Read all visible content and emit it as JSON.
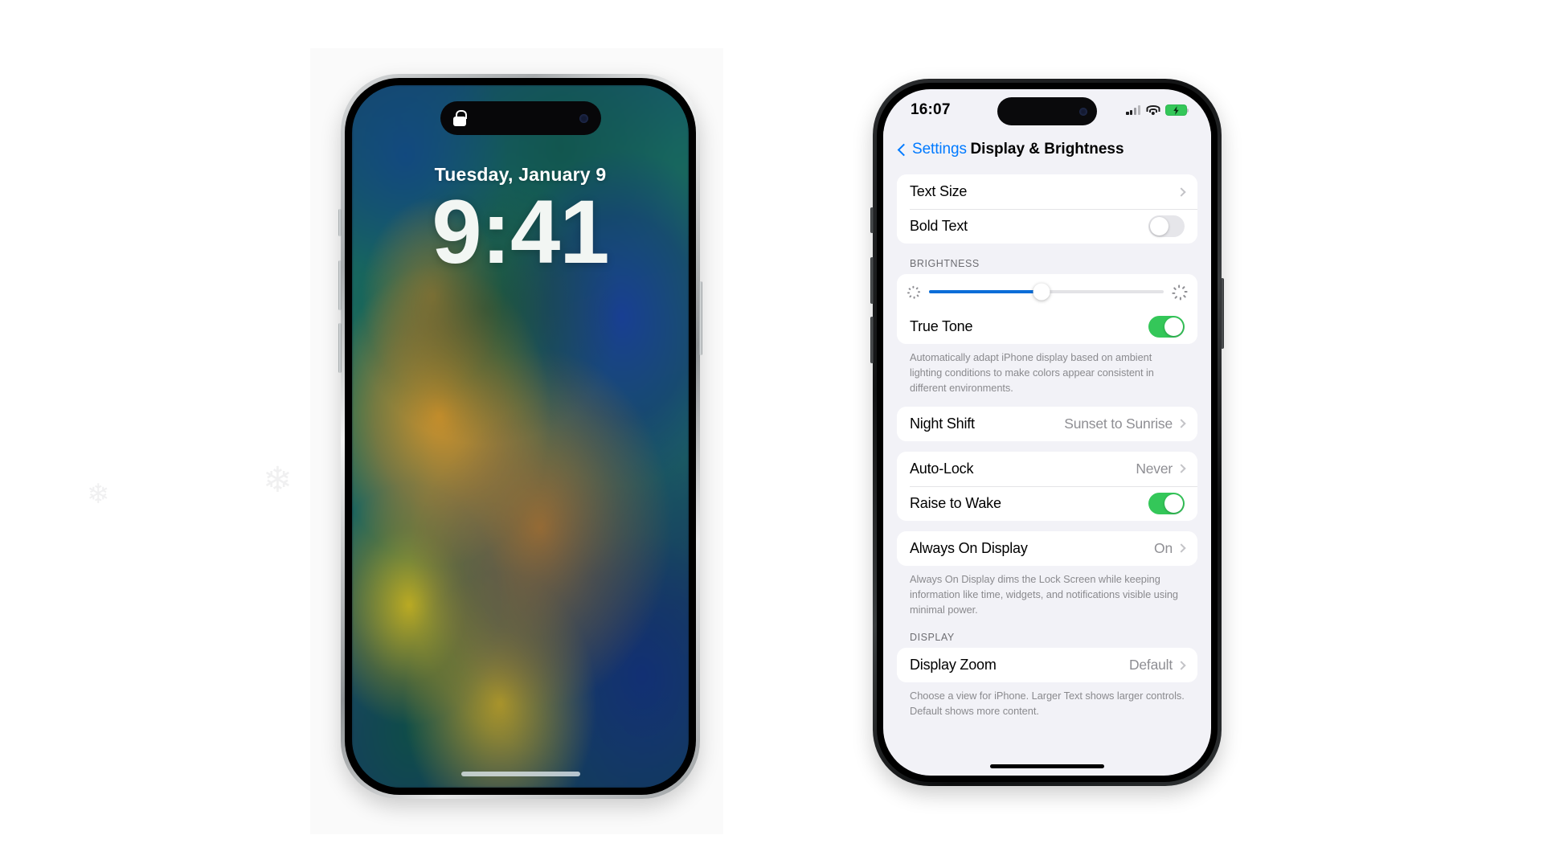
{
  "lockscreen": {
    "island_lock_icon": "lock-icon",
    "date": "Tuesday, January 9",
    "time": "9:41"
  },
  "settings_phone": {
    "status_bar": {
      "time": "16:07",
      "cellular_icon": "cellular-bars-icon",
      "wifi_icon": "wifi-icon",
      "battery_icon": "battery-charging-icon",
      "battery_color": "#34c759"
    },
    "nav": {
      "back_label": "Settings",
      "back_icon": "chevron-left-icon",
      "title": "Display & Brightness",
      "tint_color": "#007aff"
    },
    "groups": [
      {
        "rows": [
          {
            "label": "Text Size",
            "type": "disclosure",
            "value": ""
          },
          {
            "label": "Bold Text",
            "type": "toggle",
            "toggle_on": false
          }
        ]
      }
    ],
    "brightness": {
      "header": "BRIGHTNESS",
      "slider_percent": 48,
      "slider_fill_color": "#0a6dd8",
      "min_icon": "sun-dim-icon",
      "max_icon": "sun-bright-icon",
      "true_tone_label": "True Tone",
      "true_tone_on": true,
      "footnote": "Automatically adapt iPhone display based on ambient lighting conditions to make colors appear consistent in different environments."
    },
    "night_shift": {
      "label": "Night Shift",
      "value": "Sunset to Sunrise"
    },
    "lock_group": {
      "auto_lock_label": "Auto-Lock",
      "auto_lock_value": "Never",
      "raise_to_wake_label": "Raise to Wake",
      "raise_to_wake_on": true
    },
    "always_on": {
      "label": "Always On Display",
      "value": "On",
      "footnote": "Always On Display dims the Lock Screen while keeping information like time, widgets, and notifications visible using minimal power."
    },
    "display_section": {
      "header": "DISPLAY",
      "label": "Display Zoom",
      "value": "Default",
      "footnote": "Choose a view for iPhone. Larger Text shows larger controls. Default shows more content."
    }
  },
  "watermarks": {
    "glyph": "❄"
  }
}
